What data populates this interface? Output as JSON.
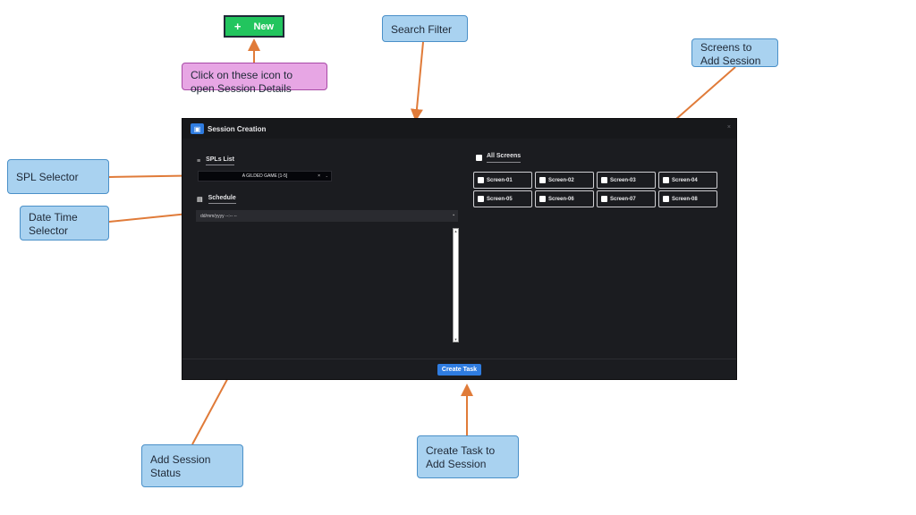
{
  "new_button": {
    "icon": "plus-icon",
    "label": "New",
    "color": "#22c55e"
  },
  "callouts": {
    "new_hint": "Click on these icon to\nopen Session Details",
    "search_filter": "Search Filter",
    "screens_to_add": "Screens to\nAdd Session",
    "spl_selector": "SPL Selector",
    "date_time_selector": "Date Time\nSelector",
    "add_session_status": "Add Session\nStatus",
    "create_task_hint": "Create Task to\nAdd Session"
  },
  "modal": {
    "title": "Session Creation",
    "close_icon": "×",
    "spl": {
      "label": "SPLs List",
      "selected": "A GILDED GAME [1-5]",
      "clear": "×",
      "arrow": "⌄"
    },
    "schedule": {
      "label": "Schedule",
      "placeholder": "dd/mm/yyyy --:-- --"
    },
    "all_screens_label": "All Screens",
    "screens": [
      "Screen-01",
      "Screen-02",
      "Screen-03",
      "Screen-04",
      "Screen-05",
      "Screen-06",
      "Screen-07",
      "Screen-08"
    ],
    "create_task_label": "Create Task"
  },
  "colors": {
    "accent": "#2f7ce0",
    "modal_bg": "#1b1c20",
    "callout_blue": "#a9d2f0",
    "callout_pink": "#e7a6e4",
    "arrow": "#e07b39"
  }
}
